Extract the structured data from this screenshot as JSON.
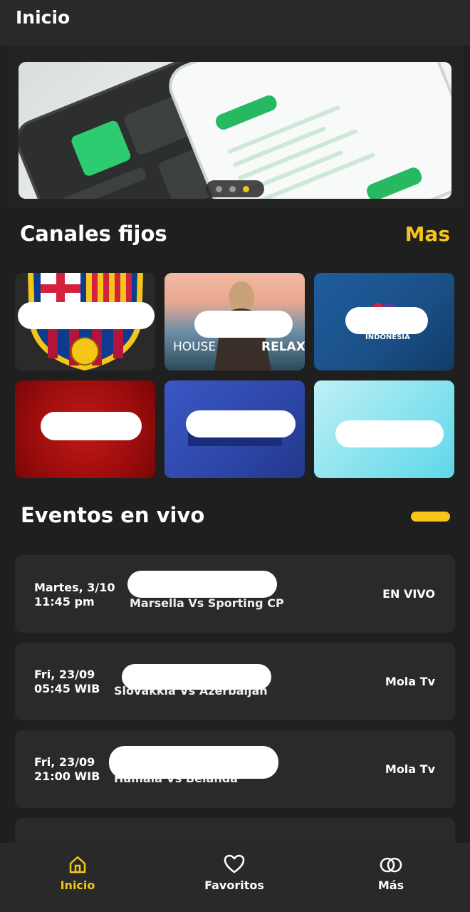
{
  "header": {
    "title": "Inicio"
  },
  "banner": {
    "dot_count": 3,
    "active_dot": 2
  },
  "canales": {
    "title": "Canales fijos",
    "more_label": "Mas",
    "items": [
      {
        "name": "",
        "label_left": "",
        "label_right": ""
      },
      {
        "name": "",
        "label_left": "HOUSE",
        "label_right": "RELAX"
      },
      {
        "name": "",
        "label_left": "INDONESIA",
        "label_right": ""
      },
      {
        "name": "",
        "label_left": "",
        "label_right": ""
      },
      {
        "name": "",
        "label_left": "",
        "label_right": ""
      },
      {
        "name": "",
        "label_left": "",
        "label_right": ""
      }
    ]
  },
  "eventos": {
    "title": "Eventos en vivo",
    "items": [
      {
        "day": "Martes, 3/10",
        "time": "11:45 pm",
        "teams": "Marsella Vs Sporting CP",
        "channel": "EN VIVO"
      },
      {
        "day": "Fri, 23/09",
        "time": "05:45 WIB",
        "teams": "Slovakkia Vs Azerbaijan",
        "channel": "Mola Tv"
      },
      {
        "day": "Fri, 23/09",
        "time": "21:00 WIB",
        "teams": "Hamala Vs Belanda",
        "channel": "Mola Tv"
      }
    ]
  },
  "nav": {
    "items": [
      {
        "label": "Inicio",
        "icon": "home-icon",
        "active": true
      },
      {
        "label": "Favoritos",
        "icon": "heart-icon",
        "active": false
      },
      {
        "label": "Más",
        "icon": "rings-icon",
        "active": false
      }
    ]
  },
  "colors": {
    "accent": "#f5c518",
    "background": "#1f1f1f",
    "card": "#2a2a2a"
  }
}
